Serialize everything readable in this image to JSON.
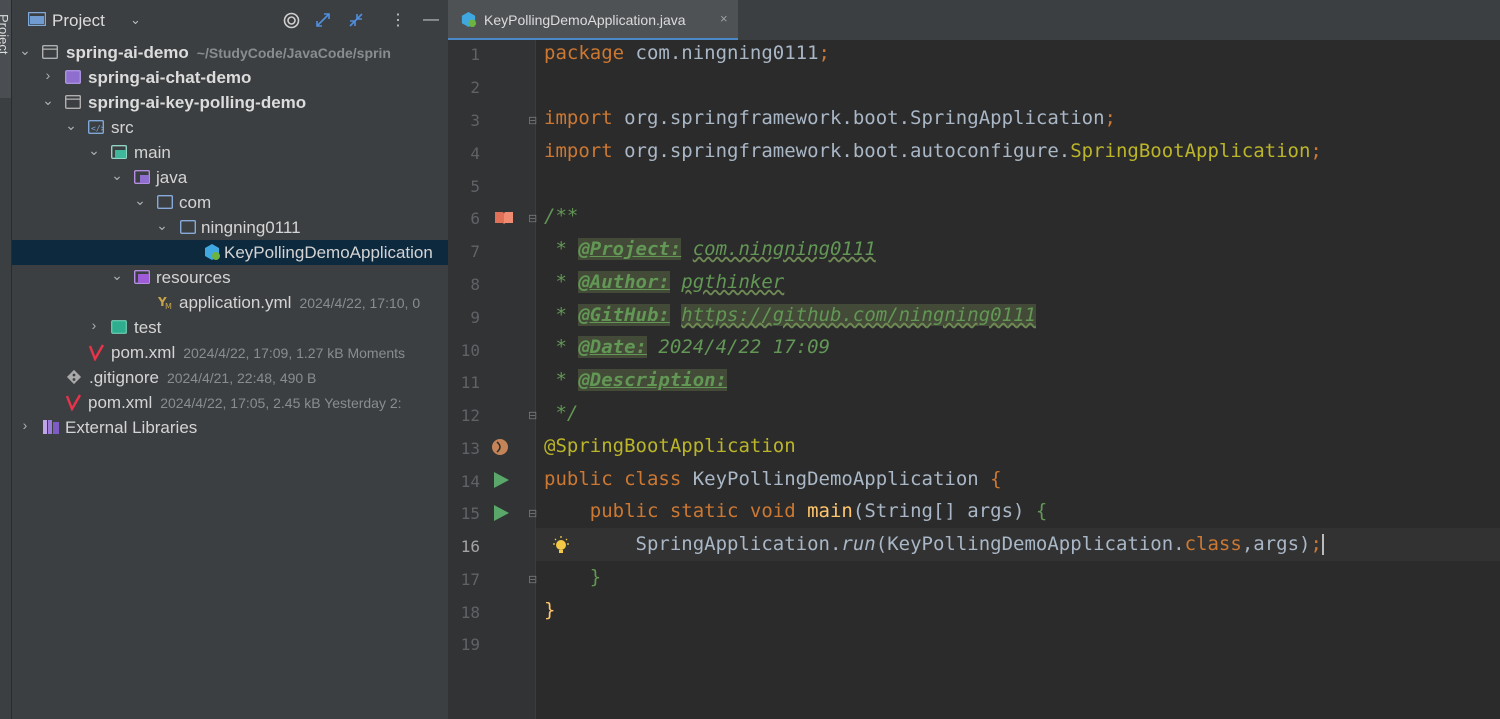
{
  "sidebar_stripe": {
    "label": "Project"
  },
  "project_panel": {
    "title": "Project",
    "tree": [
      {
        "label": "spring-ai-demo",
        "meta": "~/StudyCode/JavaCode/sprin",
        "bold": true
      },
      {
        "label": "spring-ai-chat-demo",
        "meta": "",
        "bold": true
      },
      {
        "label": "spring-ai-key-polling-demo",
        "meta": "",
        "bold": true
      },
      {
        "label": "src",
        "meta": ""
      },
      {
        "label": "main",
        "meta": ""
      },
      {
        "label": "java",
        "meta": ""
      },
      {
        "label": "com",
        "meta": ""
      },
      {
        "label": "ningning0111",
        "meta": ""
      },
      {
        "label": "KeyPollingDemoApplication",
        "meta": ""
      },
      {
        "label": "resources",
        "meta": ""
      },
      {
        "label": "application.yml",
        "meta": "2024/4/22, 17:10, 0"
      },
      {
        "label": "test",
        "meta": ""
      },
      {
        "label": "pom.xml",
        "meta": "2024/4/22, 17:09, 1.27 kB Moments"
      },
      {
        "label": ".gitignore",
        "meta": "2024/4/21, 22:48, 490 B"
      },
      {
        "label": "pom.xml",
        "meta": "2024/4/22, 17:05, 2.45 kB Yesterday 2:"
      },
      {
        "label": "External Libraries",
        "meta": ""
      }
    ]
  },
  "editor": {
    "tab": {
      "label": "KeyPollingDemoApplication.java",
      "close": "×"
    },
    "current_line": 16,
    "line_numbers": [
      "1",
      "2",
      "3",
      "4",
      "5",
      "6",
      "7",
      "8",
      "9",
      "10",
      "11",
      "12",
      "13",
      "14",
      "15",
      "16",
      "17",
      "18",
      "19"
    ],
    "code": {
      "l1_kw": "package",
      "l1_rest": " com.ningning0111",
      "l1_semi": ";",
      "l3_kw": "import",
      "l3_rest": " org.springframework.boot.SpringApplication",
      "l3_semi": ";",
      "l4_kw": "import",
      "l4_rest": " org.springframework.boot.autoconfigure.",
      "l4_ann": "SpringBootApplication",
      "l4_semi": ";",
      "l6": "/**",
      "l7_star": " * ",
      "l7_tag": "@Project:",
      "l7_val": "com.ningning0111",
      "l8_star": " * ",
      "l8_tag": "@Author:",
      "l8_val": "pgthinker",
      "l9_star": " * ",
      "l9_tag": "@GitHub:",
      "l9_val": "https://github.com/ningning0111",
      "l10_star": " * ",
      "l10_tag": "@Date:",
      "l10_val": "2024/4/22 17:09",
      "l11_star": " * ",
      "l11_tag": "@Description:",
      "l12": " */",
      "l13": "@SpringBootApplication",
      "l14_kw": "public class",
      "l14_name": " KeyPollingDemoApplication ",
      "l14_brace": "{",
      "l15_kw": "    public static void",
      "l15_fn": " main",
      "l15_rest": "(String[] args) ",
      "l15_brace": "{",
      "l16_a": "        SpringApplication.",
      "l16_run": "run",
      "l16_b": "(KeyPollingDemoApplication.",
      "l16_kw": "class",
      "l16_c": ",args)",
      "l16_semi": ";",
      "l17": "    }",
      "l18": "}"
    }
  },
  "colors": {
    "keyword": "#cc7832",
    "annotation": "#bbb529",
    "doc": "#629755",
    "selection": "#0d293e",
    "tab_underline": "#4a88c7"
  }
}
